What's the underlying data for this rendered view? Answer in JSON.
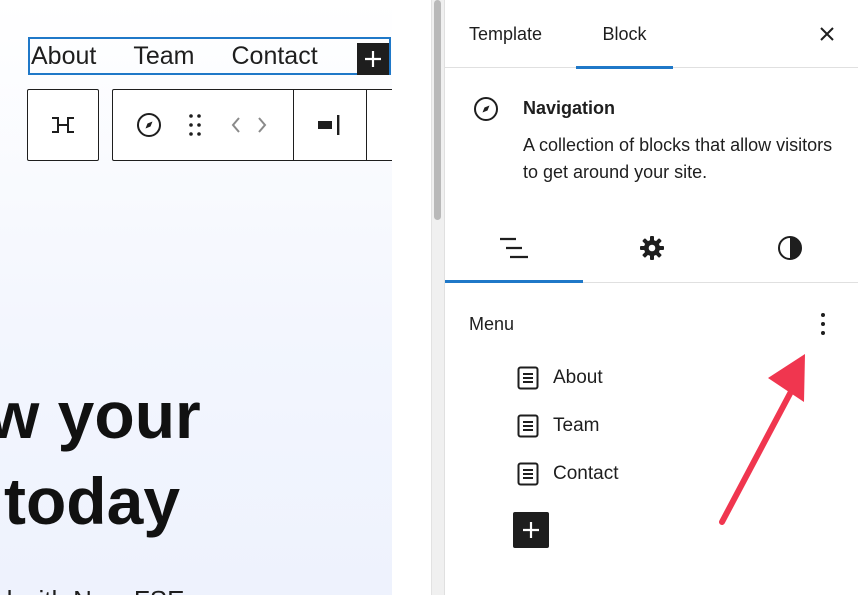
{
  "canvas": {
    "nav_links": [
      "About",
      "Team",
      "Contact"
    ],
    "hero_line_1": "w your",
    "hero_line_2": "today",
    "hero_subtext": "d with NeosFSE"
  },
  "icons": {
    "add": "plus-icon",
    "parent_select": "select-parent-icon",
    "navigation": "compass-icon",
    "drag": "drag-handle-icon",
    "move": "chevron-left-right-icon",
    "justify": "justify-right-icon",
    "more": "more-vertical-icon",
    "close": "close-icon",
    "list_view": "list-view-icon",
    "settings": "gear-icon",
    "styles": "contrast-icon",
    "page": "page-icon"
  },
  "sidebar": {
    "tabs": [
      {
        "label": "Template"
      },
      {
        "label": "Block"
      }
    ],
    "block_card": {
      "title": "Navigation",
      "description": "A collection of blocks that allow visitors to get around your site."
    },
    "menu": {
      "heading": "Menu",
      "items": [
        {
          "label": "About"
        },
        {
          "label": "Team"
        },
        {
          "label": "Contact"
        }
      ]
    }
  },
  "colors": {
    "accent": "#1f78c8",
    "dark": "#1e1e1e",
    "arrow": "#f0364f"
  }
}
